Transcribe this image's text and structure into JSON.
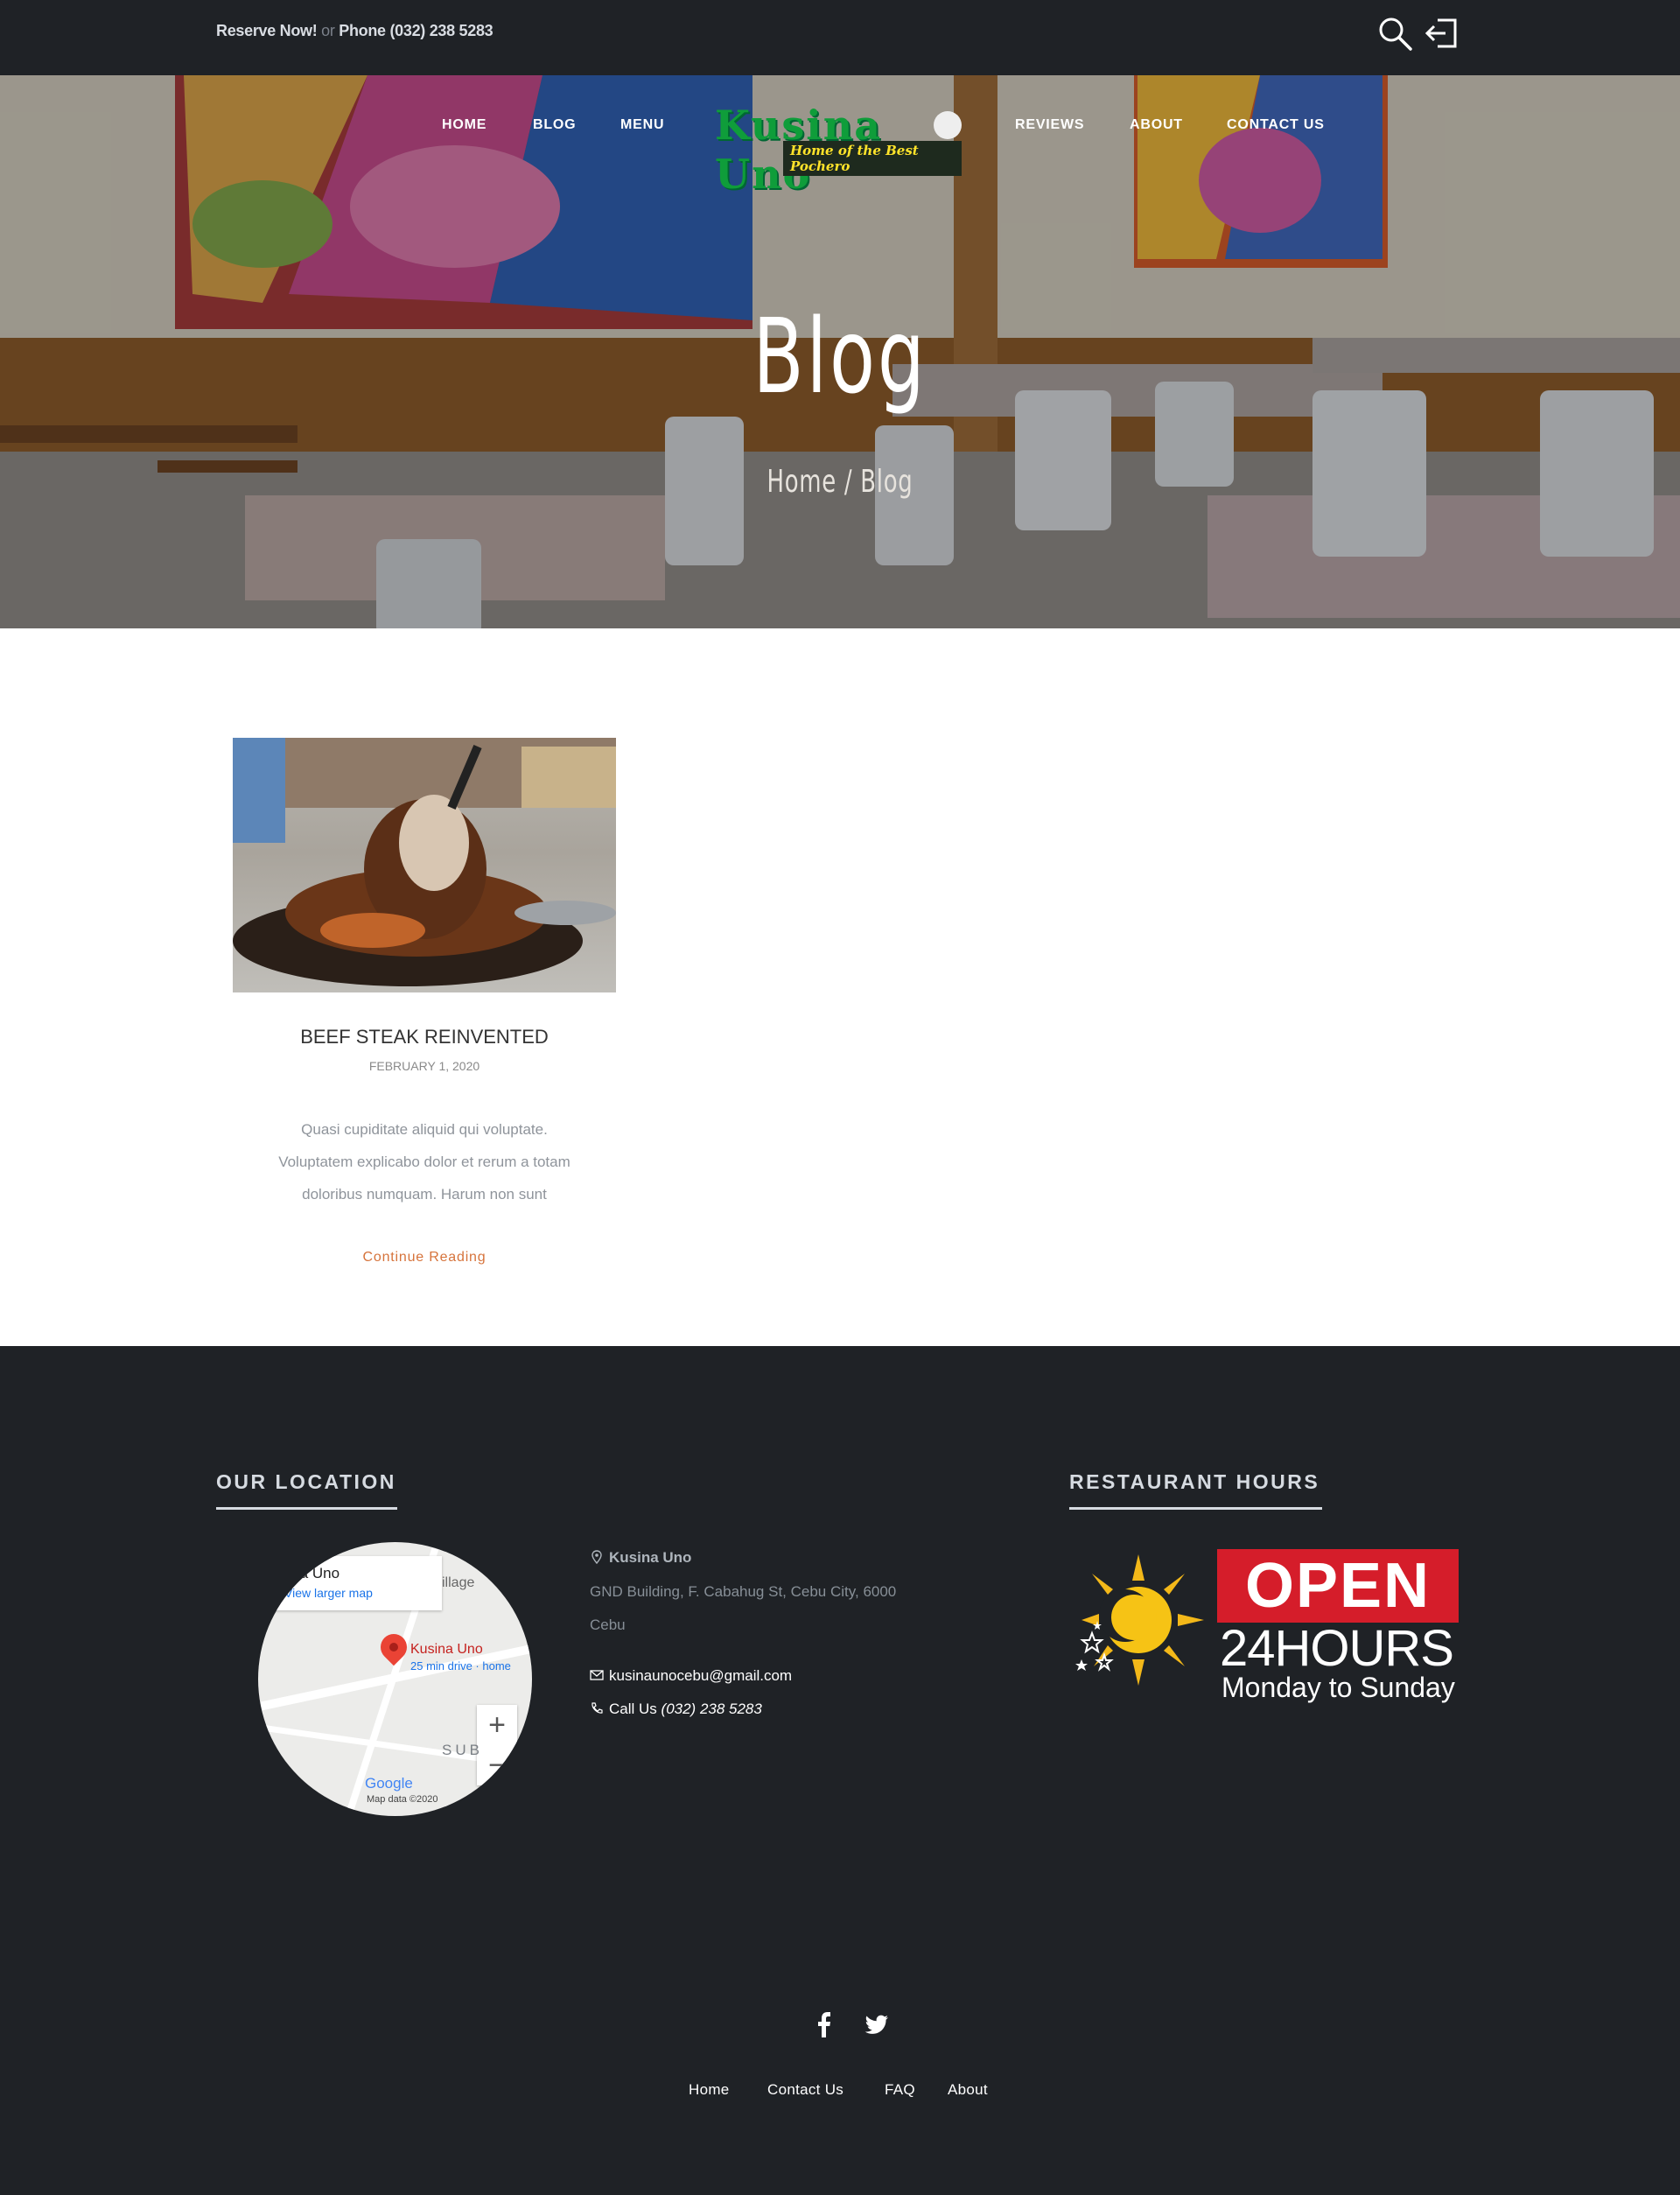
{
  "topbar": {
    "reserve": "Reserve Now!",
    "or": "or",
    "phone": "Phone (032) 238 5283",
    "icons": [
      "search-icon",
      "login-icon"
    ]
  },
  "nav": {
    "items": [
      {
        "label": "HOME"
      },
      {
        "label": "BLOG"
      },
      {
        "label": "MENU"
      },
      {
        "label": "REVIEWS"
      },
      {
        "label": "ABOUT"
      },
      {
        "label": "CONTACT US"
      }
    ]
  },
  "logo": {
    "name": "Kusina Uno",
    "tagline": "Home of the Best Pochero"
  },
  "hero": {
    "title": "Blog",
    "breadcrumb": "Home / Blog"
  },
  "post": {
    "title": "BEEF STEAK REINVENTED",
    "date": "FEBRUARY 1, 2020",
    "excerpt": "Quasi cupiditate aliquid qui voluptate. Voluptatem explicabo dolor et rerum a totam doloribus numquam. Harum non sunt",
    "more": "Continue Reading"
  },
  "footer": {
    "location_heading": "OUR LOCATION",
    "hours_heading": "RESTAURANT HOURS",
    "map": {
      "place": "sina Uno",
      "larger": "View larger map",
      "pin_label": "Kusina Uno",
      "pin_sub": "25 min drive · home",
      "village": "illage",
      "area": "SUB",
      "google": "Google",
      "mapdata": "Map data ©2020"
    },
    "address": {
      "name": "Kusina Uno",
      "line1": "GND Building, F. Cabahug St, Cebu City, 6000",
      "line2": "Cebu",
      "email": "kusinaunocebu@gmail.com",
      "call": "Call Us",
      "phone": "(032) 238 5283"
    },
    "hours": {
      "open": "OPEN",
      "hours": "24HOURS",
      "days": "Monday to Sunday"
    },
    "social": [
      "facebook-icon",
      "twitter-icon"
    ],
    "links": [
      {
        "label": "Home"
      },
      {
        "label": "Contact Us"
      },
      {
        "label": "FAQ"
      },
      {
        "label": "About"
      }
    ]
  },
  "colors": {
    "dark": "#1f2226",
    "accent": "#d6733b",
    "open_red": "#d51d2a",
    "logo_green": "#0f9d3a"
  }
}
